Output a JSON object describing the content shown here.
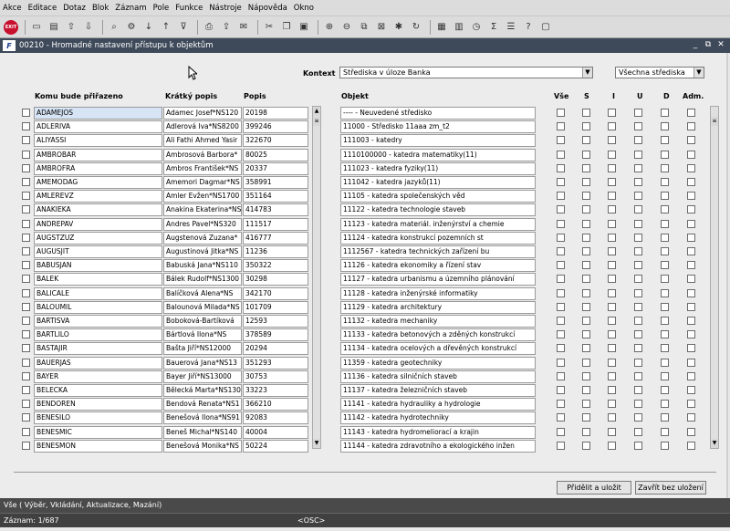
{
  "menu": [
    "Akce",
    "Editace",
    "Dotaz",
    "Blok",
    "Záznam",
    "Pole",
    "Funkce",
    "Nástroje",
    "Nápověda",
    "Okno"
  ],
  "toolbar": {
    "exit_label": "EXIT"
  },
  "window": {
    "title": "00210 - Hromadné nastavení přístupu k objektům",
    "logo": "F"
  },
  "kontext": {
    "label": "Kontext",
    "value": "Střediska v úloze Banka",
    "filter_value": "Všechna střediska"
  },
  "headers": {
    "komu": "Komu bude přiřazeno",
    "kratky": "Krátký popis",
    "popis": "Popis",
    "objekt": "Objekt",
    "vse": "Vše",
    "s": "S",
    "i": "I",
    "u": "U",
    "d": "D",
    "adm": "Adm."
  },
  "rows": [
    {
      "komu": "ADAMEJOS",
      "kratky": "Adamec Josef*NS120",
      "popis": "20198",
      "objekt": "---- - Neuvedené středisko"
    },
    {
      "komu": "ADLERIVA",
      "kratky": "Adlerová Iva*NS8200",
      "popis": "399246",
      "objekt": "11000 - Středisko 11aaa zm_t2"
    },
    {
      "komu": "ALIYASSI",
      "kratky": "Ali Fathi Ahmed Yasir",
      "popis": "322670",
      "objekt": "111003 - katedry"
    },
    {
      "komu": "AMBROBAR",
      "kratky": "Ambrosová Barbora*",
      "popis": "80025",
      "objekt": "1110100000 - katedra matematiky(11)"
    },
    {
      "komu": "AMBROFRA",
      "kratky": "Ambros František*NS",
      "popis": "20337",
      "objekt": "111023 - katedra fyziky(11)"
    },
    {
      "komu": "AMEMODAG",
      "kratky": "Amemori Dagmar*NS",
      "popis": "358991",
      "objekt": "111042 - katedra jazyků(11)"
    },
    {
      "komu": "AMLEREVZ",
      "kratky": "Amler Evžen*NS1700",
      "popis": "351164",
      "objekt": "11105 - katedra společenských věd"
    },
    {
      "komu": "ANAKIEKA",
      "kratky": "Anakina Ekaterina*NS",
      "popis": "414783",
      "objekt": "11122 - katedra technologie staveb"
    },
    {
      "komu": "ANDREPAV",
      "kratky": "Andres Pavel*NS320",
      "popis": "111517",
      "objekt": "11123 - katedra materiál. inženýrství a chemie"
    },
    {
      "komu": "AUGSTZUZ",
      "kratky": "Augstenová Zuzana*",
      "popis": "416777",
      "objekt": "11124 - katedra konstrukcí pozemních st"
    },
    {
      "komu": "AUGUSJIT",
      "kratky": "Augustinová Jitka*NS",
      "popis": "11236",
      "objekt": "1112567 - katedra technických zařízení bu"
    },
    {
      "komu": "BABUSJAN",
      "kratky": "Babuská Jana*NS110",
      "popis": "350322",
      "objekt": "11126 - katedra ekonomiky a řízení stav"
    },
    {
      "komu": "BALEK",
      "kratky": "Bálek Rudolf*NS1300",
      "popis": "30298",
      "objekt": "11127 - katedra urbanismu a územního plánování"
    },
    {
      "komu": "BALICALE",
      "kratky": "Balíčková Alena*NS",
      "popis": "342170",
      "objekt": "11128 - katedra inženýrské informatiky"
    },
    {
      "komu": "BALOUMIL",
      "kratky": "Balounová Milada*NS",
      "popis": "101709",
      "objekt": "11129 - katedra architektury"
    },
    {
      "komu": "BARTISVA",
      "kratky": "Boboková-Bartíková",
      "popis": "12593",
      "objekt": "11132 - katedra mechaniky"
    },
    {
      "komu": "BARTLILO",
      "kratky": "Bártlová Ilona*NS",
      "popis": "378589",
      "objekt": "11133 - katedra betonových a zděných konstrukcí"
    },
    {
      "komu": "BASTAJIR",
      "kratky": "Bašta Jiří*NS12000",
      "popis": "20294",
      "objekt": "11134 - katedra ocelových a dřevěných konstrukcí"
    },
    {
      "komu": "BAUERJAS",
      "kratky": "Bauerová Jana*NS13",
      "popis": "351293",
      "objekt": "11359 - katedra geotechniky"
    },
    {
      "komu": "BAYER",
      "kratky": "Bayer Jiří*NS13000",
      "popis": "30753",
      "objekt": "11136 - katedra silničních staveb"
    },
    {
      "komu": "BELECKA",
      "kratky": "Bělecká Marta*NS130",
      "popis": "33223",
      "objekt": "11137 - katedra železničních staveb"
    },
    {
      "komu": "BENDOREN",
      "kratky": "Bendová Renata*NS1",
      "popis": "366210",
      "objekt": "11141 - katedra hydrauliky a hydrologie"
    },
    {
      "komu": "BENESILO",
      "kratky": "Benešová Ilona*NS91",
      "popis": "92083",
      "objekt": "11142 - katedra hydrotechniky"
    },
    {
      "komu": "BENESMIC",
      "kratky": "Beneš Michal*NS140",
      "popis": "40004",
      "objekt": "11143 - katedra hydromeliorací a krajin"
    },
    {
      "komu": "BENESMON",
      "kratky": "Benešová Monika*NS",
      "popis": "50224",
      "objekt": "11144 - katedra zdravotního a ekologického inžen"
    }
  ],
  "buttons": {
    "assign": "Přidělit a uložit",
    "close": "Zavřít bez uložení"
  },
  "status": {
    "line1": "Vše ( Výběr, Vkládání, Aktualizace, Mazání)",
    "record": "Záznam: 1/687",
    "osc": "<OSC>"
  }
}
